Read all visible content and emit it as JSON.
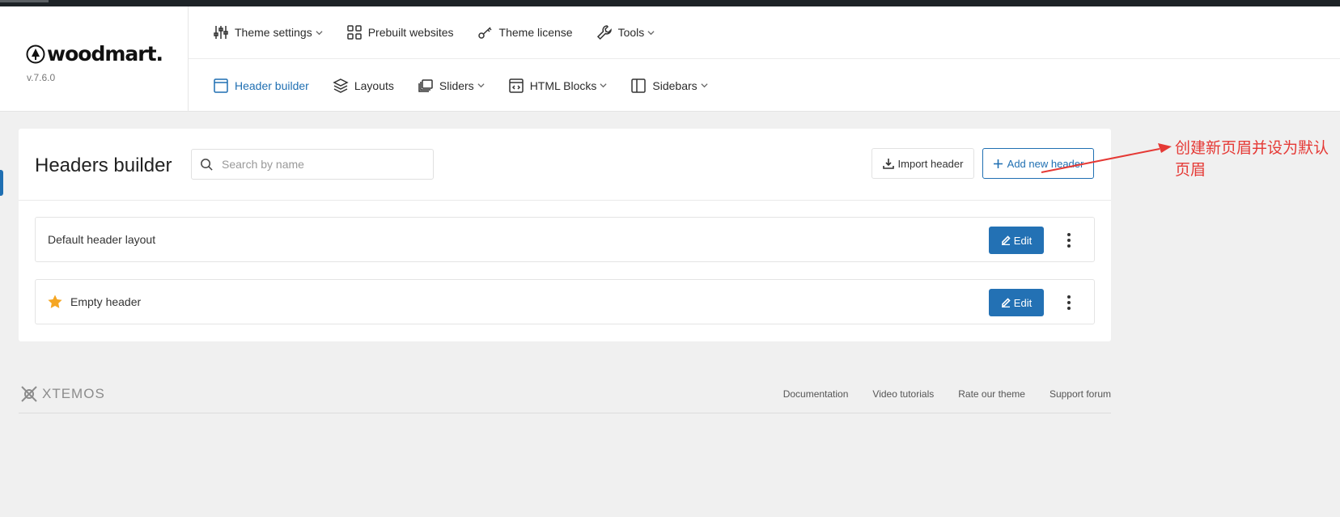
{
  "brand": {
    "name": "woodmart.",
    "version": "v.7.6.0"
  },
  "nav_top": [
    {
      "label": "Theme settings",
      "icon": "sliders-icon",
      "dropdown": true
    },
    {
      "label": "Prebuilt websites",
      "icon": "grid-icon",
      "dropdown": false
    },
    {
      "label": "Theme license",
      "icon": "key-icon",
      "dropdown": false
    },
    {
      "label": "Tools",
      "icon": "wrench-icon",
      "dropdown": true
    }
  ],
  "nav_bottom": [
    {
      "label": "Header builder",
      "icon": "window-icon",
      "dropdown": false,
      "active": true
    },
    {
      "label": "Layouts",
      "icon": "layers-icon",
      "dropdown": false
    },
    {
      "label": "Sliders",
      "icon": "slides-icon",
      "dropdown": true
    },
    {
      "label": "HTML Blocks",
      "icon": "code-window-icon",
      "dropdown": true
    },
    {
      "label": "Sidebars",
      "icon": "sidebar-icon",
      "dropdown": true
    }
  ],
  "main": {
    "title": "Headers builder",
    "search_placeholder": "Search by name",
    "import_label": "Import header",
    "add_label": "Add new header",
    "rows": [
      {
        "name": "Default header layout",
        "default": false,
        "edit_label": "Edit"
      },
      {
        "name": "Empty header",
        "default": true,
        "edit_label": "Edit"
      }
    ]
  },
  "footer": {
    "logo_text": "XTEMOS",
    "links": [
      "Documentation",
      "Video tutorials",
      "Rate our theme",
      "Support forum"
    ]
  },
  "annotation": {
    "text": "创建新页眉并设为默认页眉"
  },
  "colors": {
    "accent": "#1f6fb2",
    "edit_button": "#2371b4",
    "star": "#f5a623",
    "annotation": "#e53935"
  }
}
